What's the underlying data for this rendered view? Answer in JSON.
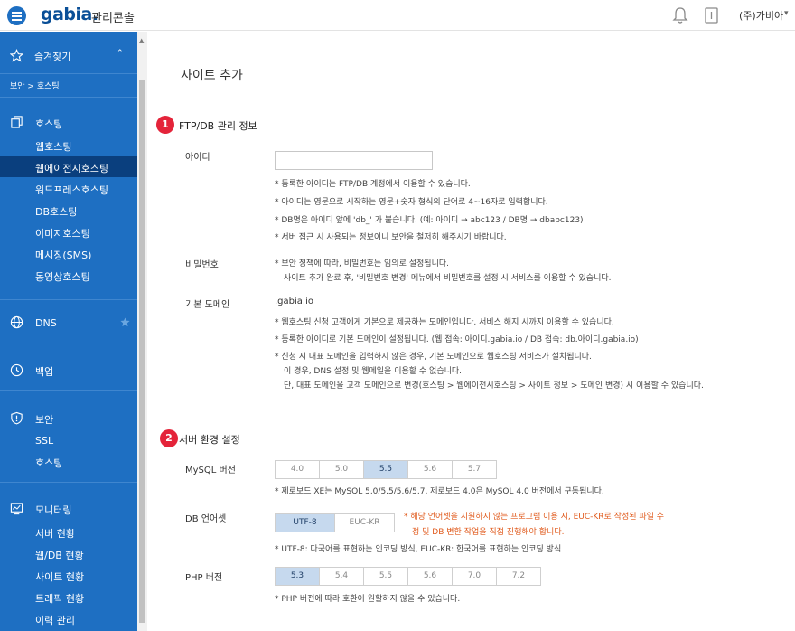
{
  "header": {
    "logo": "gabia.",
    "logo_sub": "관리콘솔",
    "user": "(주)가비아"
  },
  "sidebar": {
    "favorites": "즐겨찾기",
    "breadcrumb": "보안 > 호스팅",
    "groups": [
      {
        "label": "호스팅",
        "items": [
          "웹호스팅",
          "웹에이전시호스팅",
          "워드프레스호스팅",
          "DB호스팅",
          "이미지호스팅",
          "메시징(SMS)",
          "동영상호스팅"
        ],
        "active": "웹에이전시호스팅"
      },
      {
        "label": "DNS",
        "items": []
      },
      {
        "label": "백업",
        "items": []
      },
      {
        "label": "보안",
        "items": [
          "SSL",
          "호스팅"
        ]
      },
      {
        "label": "모니터링",
        "items": [
          "서버 현황",
          "웹/DB 현황",
          "사이트 현황",
          "트래픽 현황",
          "이력 관리"
        ]
      }
    ]
  },
  "main": {
    "page_title": "사이트 추가",
    "section1": {
      "num": "1",
      "title": "FTP/DB 관리 정보",
      "id_label": "아이디",
      "id_value": "",
      "id_notes": [
        "*  등록한 아이디는 FTP/DB 계정에서 이용할 수 있습니다.",
        "*  아이디는 영문으로 시작하는 영문+숫자 형식의 단어로 4~16자로 입력합니다.",
        "*  DB명은 아이디 앞에 'db_' 가 붙습니다. (예: 아이디 → abc123 / DB명 → dbabc123)",
        "*  서버 접근 시 사용되는 정보이니 보안을 철저히 해주시기 바랍니다."
      ],
      "pw_label": "비밀번호",
      "pw_notes": [
        "*  보안 정책에 따라, 비밀번호는 임의로 설정됩니다.",
        "사이트 추가 완료 후, '비밀번호 변경' 메뉴에서 비밀번호를 설정 시 서비스를 이용할 수 있습니다."
      ],
      "domain_label": "기본 도메인",
      "domain_value": ".gabia.io",
      "domain_notes": [
        "*  웹호스팅 신청 고객에게 기본으로 제공하는 도메인입니다. 서비스 해지 시까지 이용할 수 있습니다.",
        "*  등록한 아이디로 기본 도메인이 설정됩니다. (웹 접속: 아이디.gabia.io / DB 접속: db.아이디.gabia.io)",
        "*  신청 시 대표 도메인을 입력하지 않은 경우, 기본 도메인으로 웹호스팅 서비스가 설치됩니다.",
        "이 경우, DNS 설정 및 웹메일을 이용할 수 없습니다.",
        "단, 대표 도메인을 고객 도메인으로 변경(호스팅 > 웹에이전시호스팅 > 사이트 정보 > 도메인 변경) 시 이용할 수 있습니다."
      ]
    },
    "section2": {
      "num": "2",
      "title": "서버 환경 설정",
      "mysql_label": "MySQL 버전",
      "mysql_options": [
        "4.0",
        "5.0",
        "5.5",
        "5.6",
        "5.7"
      ],
      "mysql_selected": "5.5",
      "mysql_note": "*  제로보드 XE는 MySQL 5.0/5.5/5.6/5.7, 제로보드 4.0은 MySQL 4.0 버전에서 구동됩니다.",
      "charset_label": "DB 언어셋",
      "charset_options": [
        "UTF-8",
        "EUC-KR"
      ],
      "charset_selected": "UTF-8",
      "charset_warning": [
        "* 해당 언어셋을 지원하지 않는 프로그램 이용 시, EUC-KR로 작성된 파일 수",
        "정 및 DB 변환 작업을 직접 진행해야 합니다."
      ],
      "charset_note": "*  UTF-8: 다국어를 표현하는 인코딩 방식, EUC-KR: 한국어를 표현하는 인코딩 방식",
      "php_label": "PHP 버전",
      "php_options": [
        "5.3",
        "5.4",
        "5.5",
        "5.6",
        "7.0",
        "7.2"
      ],
      "php_selected": "5.3",
      "php_note": "*  PHP 버전에 따라 호환이 원활하지 않을 수 있습니다."
    }
  },
  "colors": {
    "sidebar": "#1e6fc2",
    "active": "#0a3f7e",
    "accent": "#e4243a",
    "selected": "#c6d9ee"
  }
}
